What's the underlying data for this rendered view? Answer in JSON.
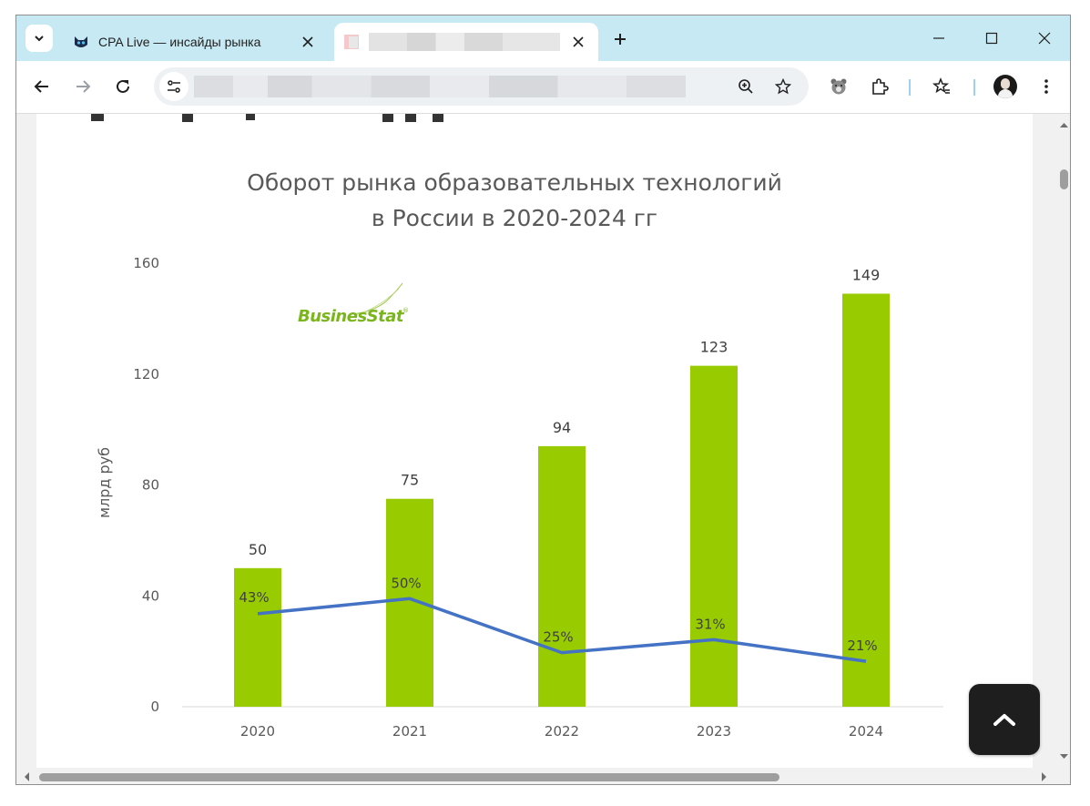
{
  "browser": {
    "tabs": [
      {
        "title": "CPA Live — инсайды рынка",
        "icon": "cat-mascot-icon"
      },
      {
        "title": "",
        "icon": "blurred-favicon-icon"
      }
    ],
    "address_bar": {
      "url": ""
    }
  },
  "chart_data": {
    "type": "bar",
    "title_lines": [
      "Оборот рынка образовательных технологий",
      "в России в  2020-2024 гг"
    ],
    "ylabel": "млрд  руб",
    "ylim": [
      0,
      160
    ],
    "yticks": [
      "0",
      "40",
      "80",
      "120",
      "160"
    ],
    "categories": [
      "2020",
      "2021",
      "2022",
      "2023",
      "2024"
    ],
    "values": [
      50,
      75,
      94,
      123,
      149
    ],
    "value_labels": [
      "50",
      "75",
      "94",
      "123",
      "149"
    ],
    "bar_color": "#99cc00",
    "growth_series": {
      "type": "line",
      "values": [
        43,
        50,
        25,
        31,
        21
      ],
      "labels": [
        "43%",
        "50%",
        "25%",
        "31%",
        "21%"
      ],
      "color": "#4472c4"
    },
    "logo": {
      "text": "BusinesStat",
      "color": "#7ab51d"
    }
  }
}
